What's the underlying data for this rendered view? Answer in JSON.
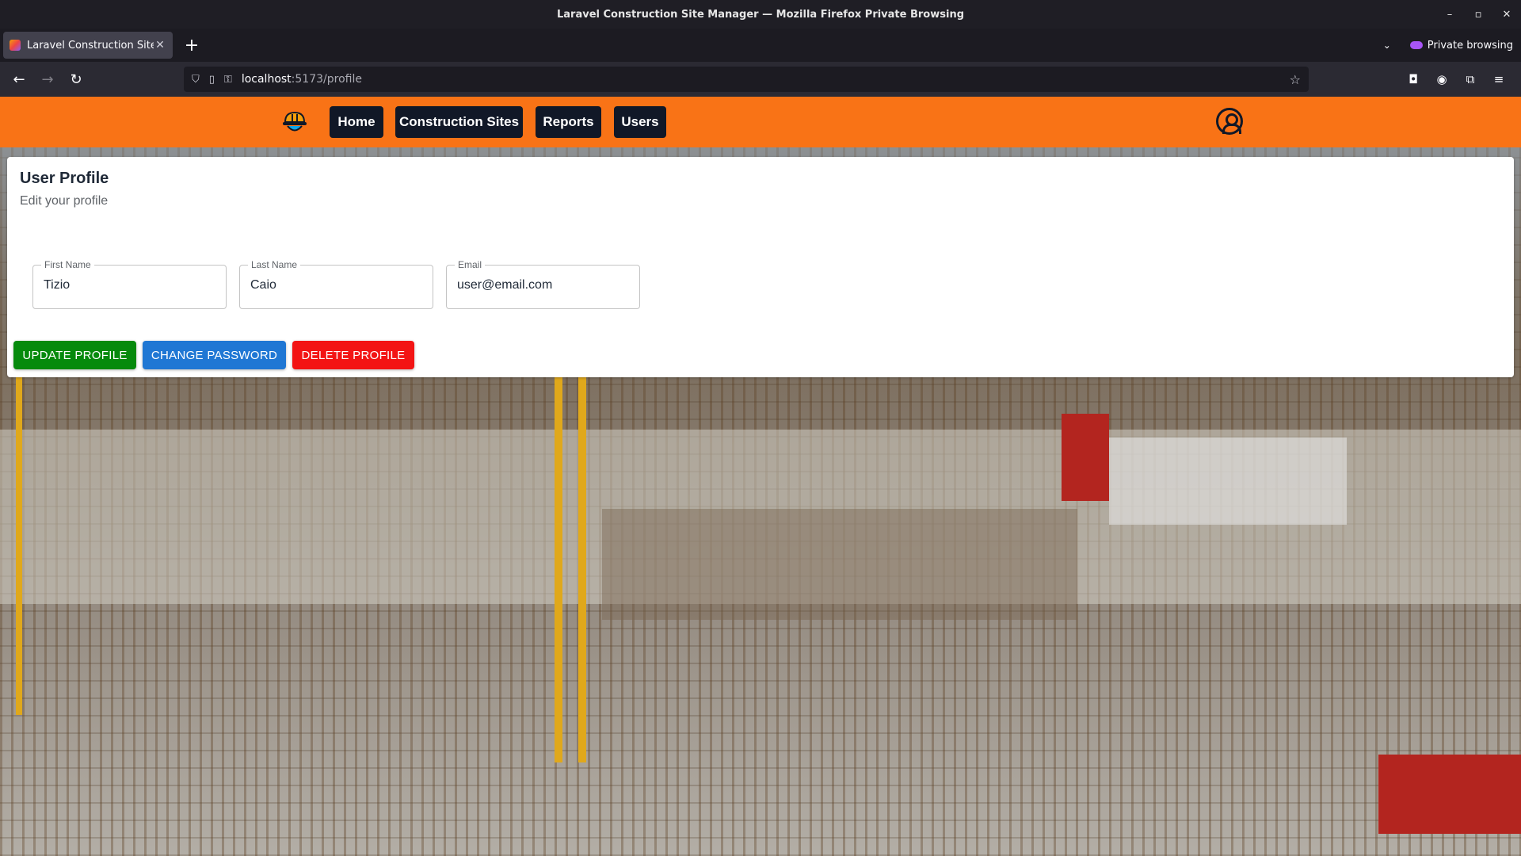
{
  "window": {
    "title": "Laravel Construction Site Manager — Mozilla Firefox Private Browsing",
    "controls": [
      "–",
      "▫",
      "✕"
    ]
  },
  "tabs": [
    {
      "label": "Laravel Construction Site Ma",
      "close": "✕"
    }
  ],
  "browser": {
    "new_tab": "+",
    "private_label": "Private browsing",
    "url_host": "localhost",
    "url_path": ":5173/profile",
    "icons": {
      "back": "←",
      "forward": "→",
      "reload": "↻",
      "shield": "⛉",
      "page": "▯",
      "key": "⚿",
      "star": "☆",
      "pocket": "◘",
      "account": "◉",
      "extensions": "⧉",
      "menu": "≡",
      "list_all_tabs": "⌄"
    }
  },
  "app": {
    "header_color": "#f97316",
    "menu_color": "#111827",
    "nav": [
      "Home",
      "Construction Sites",
      "Reports",
      "Users"
    ]
  },
  "profile": {
    "title": "User Profile",
    "subtitle": "Edit your profile",
    "fields": [
      {
        "label": "First Name",
        "value": "Tizio"
      },
      {
        "label": "Last Name",
        "value": "Caio"
      },
      {
        "label": "Email",
        "value": "user@email.com"
      }
    ],
    "buttons": [
      {
        "label": "UPDATE PROFILE",
        "color": "#068a0c"
      },
      {
        "label": "CHANGE PASSWORD",
        "color": "#1f77d4"
      },
      {
        "label": "DELETE PROFILE",
        "color": "#f31414"
      }
    ]
  }
}
